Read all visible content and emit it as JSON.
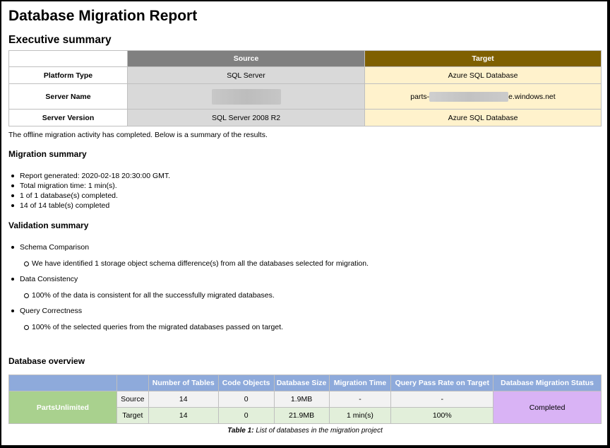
{
  "report_title": "Database Migration Report",
  "executive_summary": {
    "heading": "Executive summary",
    "columns": {
      "source": "Source",
      "target": "Target"
    },
    "rows": [
      {
        "label": "Platform Type",
        "source": "SQL Server",
        "target": "Azure SQL Database"
      },
      {
        "label": "Server Name",
        "source": "",
        "target_prefix": "parts-",
        "target_suffix": "e.windows.net"
      },
      {
        "label": "Server Version",
        "source": "SQL Server 2008 R2",
        "target": "Azure SQL Database"
      }
    ],
    "completion_text": "The offline migration activity has completed. Below is a summary of the results."
  },
  "migration_summary": {
    "heading": "Migration summary",
    "items": [
      "Report generated: 2020-02-18 20:30:00 GMT.",
      "Total migration time: 1 min(s).",
      "1 of 1 database(s) completed.",
      "14 of 14 table(s) completed"
    ]
  },
  "validation_summary": {
    "heading": "Validation summary",
    "items": [
      {
        "label": "Schema Comparison",
        "detail": "We have identified 1 storage object schema difference(s) from all the databases selected for migration."
      },
      {
        "label": "Data Consistency",
        "detail": "100% of the data is consistent for all the successfully migrated databases."
      },
      {
        "label": "Query Correctness",
        "detail": "100% of the selected queries from the migrated databases passed on target."
      }
    ]
  },
  "database_overview": {
    "heading": "Database overview",
    "headers": [
      "Number of Tables",
      "Code Objects",
      "Database Size",
      "Migration Time",
      "Query Pass Rate on Target",
      "Database Migration Status"
    ],
    "database_name": "PartsUnlimited",
    "status": "Completed",
    "source_row": {
      "label": "Source",
      "tables": "14",
      "code_objects": "0",
      "size": "1.9MB",
      "time": "-",
      "pass_rate": "-"
    },
    "target_row": {
      "label": "Target",
      "tables": "14",
      "code_objects": "0",
      "size": "21.9MB",
      "time": "1 min(s)",
      "pass_rate": "100%"
    },
    "caption_label": "Table 1:",
    "caption_text": "List of databases in the migration project"
  }
}
